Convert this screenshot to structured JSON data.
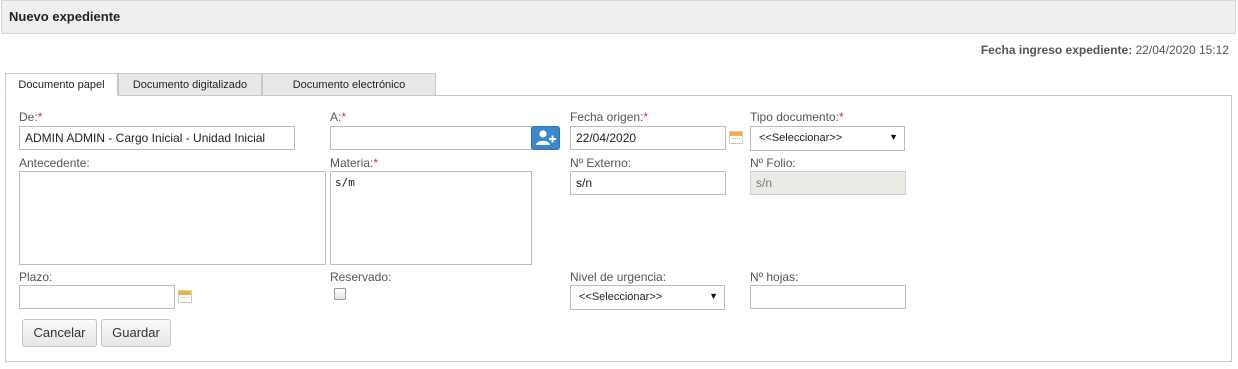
{
  "header": {
    "title": "Nuevo expediente"
  },
  "ingreso": {
    "label": "Fecha ingreso expediente:",
    "value": "22/04/2020 15:12"
  },
  "tabs": [
    {
      "label": "Documento papel",
      "active": true
    },
    {
      "label": "Documento digitalizado",
      "active": false
    },
    {
      "label": "Documento electrónico",
      "active": false
    }
  ],
  "form": {
    "de": {
      "label": "De:",
      "required": "*",
      "value": "ADMIN ADMIN - Cargo Inicial - Unidad Inicial"
    },
    "a": {
      "label": "A:",
      "required": "*",
      "value": ""
    },
    "fecha_origen": {
      "label": "Fecha origen:",
      "required": "*",
      "value": "22/04/2020"
    },
    "tipo_documento": {
      "label": "Tipo documento:",
      "required": "*",
      "selected": "<<Seleccionar>>"
    },
    "antecedente": {
      "label": "Antecedente:",
      "value": ""
    },
    "materia": {
      "label": "Materia:",
      "required": "*",
      "value": "s/m"
    },
    "n_externo": {
      "label": "Nº Externo:",
      "value": "s/n"
    },
    "n_folio": {
      "label": "Nº Folio:",
      "value": "s/n"
    },
    "plazo": {
      "label": "Plazo:",
      "value": ""
    },
    "reservado": {
      "label": "Reservado:",
      "checked": false
    },
    "nivel_urgencia": {
      "label": "Nivel de urgencia:",
      "selected": "<<Seleccionar>>"
    },
    "n_hojas": {
      "label": "Nº hojas:",
      "value": ""
    }
  },
  "buttons": {
    "cancel": "Cancelar",
    "save": "Guardar"
  },
  "colors": {
    "required": "#e03030",
    "add_button": "#3b88cc",
    "calendar": "#f1b33a"
  },
  "icons": {
    "calendar": "calendar-icon",
    "add_user": "add-user-icon",
    "dropdown": "chevron-down-icon"
  }
}
